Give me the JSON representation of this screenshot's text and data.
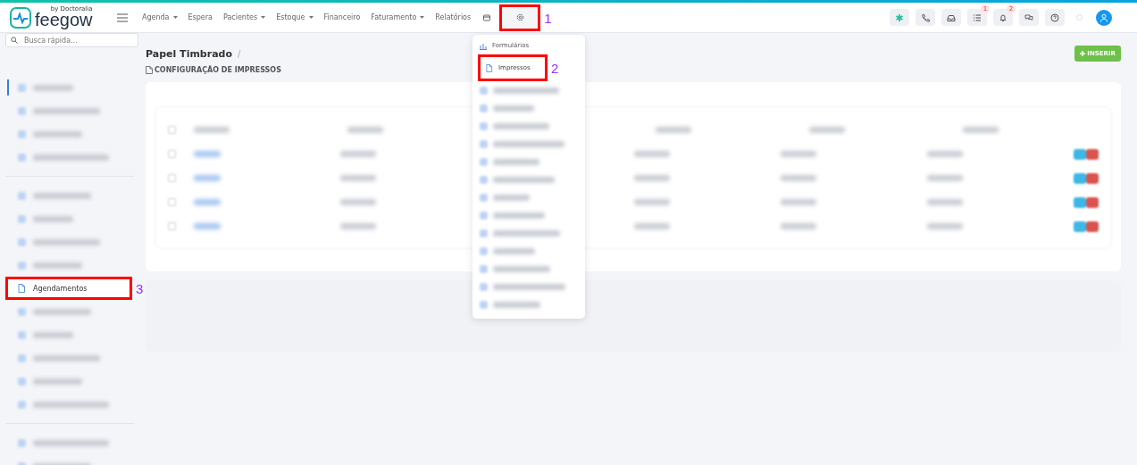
{
  "header": {
    "logo": {
      "name": "feegow",
      "tagline": "by Doctoralia"
    },
    "nav": [
      {
        "label": "Agenda",
        "dropdown": true
      },
      {
        "label": "Espera",
        "dropdown": false
      },
      {
        "label": "Pacientes",
        "dropdown": true
      },
      {
        "label": "Estoque",
        "dropdown": true
      },
      {
        "label": "Financeiro",
        "dropdown": false
      },
      {
        "label": "Faturamento",
        "dropdown": true
      },
      {
        "label": "Relatórios",
        "dropdown": false
      }
    ],
    "settings": {
      "marked": true,
      "annotation": "1",
      "expanded": true
    },
    "tools": [
      {
        "kind": "star"
      },
      {
        "kind": "phone"
      },
      {
        "kind": "inbox"
      },
      {
        "kind": "list",
        "badge": "1"
      },
      {
        "kind": "bell",
        "badge": "2"
      },
      {
        "kind": "chat"
      },
      {
        "kind": "help"
      }
    ],
    "search": {
      "placeholder": "Busca rápida..."
    }
  },
  "sidebar": {
    "groups": [
      {
        "items": [
          {
            "kind": "blurred",
            "selected": true
          },
          {
            "kind": "blurred",
            "selected": false
          },
          {
            "kind": "blurred",
            "selected": false
          },
          {
            "kind": "blurred",
            "selected": false
          }
        ]
      },
      {
        "items": [
          {
            "kind": "blurred",
            "selected": false
          },
          {
            "kind": "blurred",
            "selected": false
          },
          {
            "kind": "blurred",
            "selected": false
          },
          {
            "kind": "blurred",
            "selected": false
          },
          {
            "kind": "item",
            "label": "Agendamentos",
            "selected": false,
            "marked": true,
            "annotation": "3"
          },
          {
            "kind": "blurred",
            "selected": false
          },
          {
            "kind": "blurred",
            "selected": false
          },
          {
            "kind": "blurred",
            "selected": false
          },
          {
            "kind": "blurred",
            "selected": false
          },
          {
            "kind": "blurred",
            "selected": false
          }
        ]
      },
      {
        "items": [
          {
            "kind": "blurred",
            "selected": false
          },
          {
            "kind": "blurred",
            "selected": false
          }
        ]
      }
    ]
  },
  "page": {
    "breadcrumb": "Papel Timbrado",
    "separator": "/",
    "section_title": "CONFIGURAÇÃO DE IMPRESSOS",
    "insert_button": "INSERIR",
    "table": {
      "columns": [
        {
          "kind": "blurred"
        },
        {
          "kind": "blurred"
        },
        {
          "kind": "blurred"
        },
        {
          "kind": "blurred"
        },
        {
          "kind": "blurred"
        },
        {
          "kind": "blurred"
        }
      ],
      "rows": [
        {
          "kind": "blurred"
        },
        {
          "kind": "blurred"
        },
        {
          "kind": "blurred"
        },
        {
          "kind": "blurred"
        }
      ]
    }
  },
  "menu": {
    "items": [
      {
        "kind": "item",
        "label": "Formulários",
        "marked": false
      },
      {
        "kind": "item",
        "label": "Impressos",
        "marked": true,
        "annotation": "2"
      },
      {
        "kind": "blurred"
      },
      {
        "kind": "blurred"
      },
      {
        "kind": "blurred"
      },
      {
        "kind": "blurred"
      },
      {
        "kind": "blurred"
      },
      {
        "kind": "blurred"
      },
      {
        "kind": "blurred"
      },
      {
        "kind": "blurred"
      },
      {
        "kind": "blurred"
      },
      {
        "kind": "blurred"
      },
      {
        "kind": "blurred"
      },
      {
        "kind": "blurred"
      },
      {
        "kind": "blurred"
      }
    ]
  }
}
